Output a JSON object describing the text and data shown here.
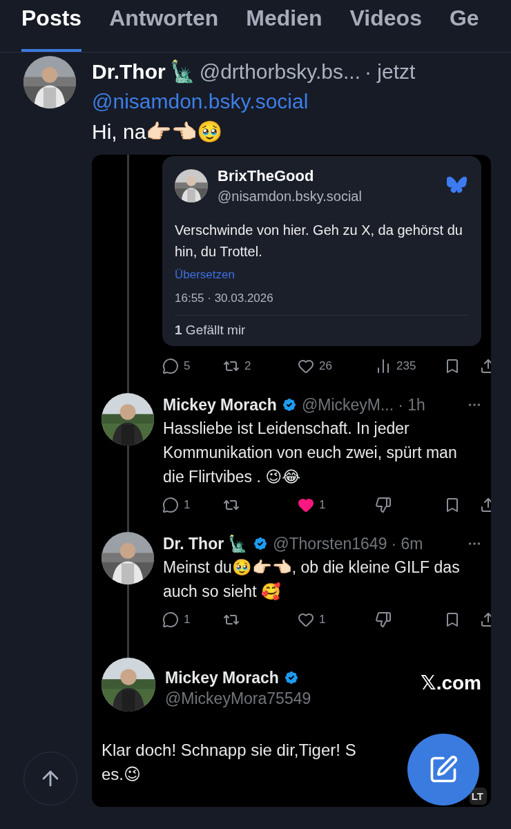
{
  "tabs": [
    {
      "label": "Posts",
      "selected": true
    },
    {
      "label": "Antworten",
      "selected": false
    },
    {
      "label": "Medien",
      "selected": false
    },
    {
      "label": "Videos",
      "selected": false
    },
    {
      "label": "Ge",
      "selected": false
    }
  ],
  "post": {
    "author": "Dr.Thor",
    "author_emoji": "🗽",
    "handle": "@drthorbsky.bs...",
    "time": "· jetzt",
    "mention": "@nisamdon.bsky.social",
    "text": "Hi, na👉🏻👈🏻🥹",
    "screenshot": {
      "quoted": {
        "name": "BrixTheGood",
        "handle": "@nisamdon.bsky.social",
        "text": "Verschwinde von hier. Geh zu X, da gehörst du hin, du Trottel.",
        "translate": "Übersetzen",
        "timestamp": "16:55 · 30.03.2026",
        "likes_count": "1",
        "likes_label": "Gefällt mir"
      },
      "actions": [
        {
          "kind": "reply",
          "count": "5"
        },
        {
          "kind": "repost",
          "count": "2"
        },
        {
          "kind": "like",
          "count": "26",
          "liked": false
        },
        {
          "kind": "views",
          "count": "235"
        },
        {
          "kind": "bookmark"
        },
        {
          "kind": "share"
        }
      ],
      "replies": [
        {
          "name": "Mickey Morach",
          "verified": true,
          "handle": "@MickeyM...",
          "time": "· 1h",
          "text": "Hassliebe ist Leidenschaft. In jeder Kommunikation von euch zwei, spürt man die Flirtvibes . 😉😂",
          "actions": [
            {
              "kind": "reply",
              "count": "1"
            },
            {
              "kind": "repost"
            },
            {
              "kind": "like",
              "count": "1",
              "liked": true
            },
            {
              "kind": "dislike"
            },
            {
              "kind": "bookmark"
            },
            {
              "kind": "share"
            }
          ]
        },
        {
          "name": "Dr. Thor",
          "name_emoji": "🗽",
          "verified": true,
          "handle": "@Thorsten1649",
          "time": "· 6m",
          "text": "Meinst du🥹👉🏻👈🏻, ob die kleine GILF das auch so sieht 🥰",
          "actions": [
            {
              "kind": "reply",
              "count": "1"
            },
            {
              "kind": "repost"
            },
            {
              "kind": "like",
              "count": "1",
              "liked": false
            },
            {
              "kind": "dislike"
            },
            {
              "kind": "bookmark"
            },
            {
              "kind": "share"
            }
          ]
        }
      ],
      "final": {
        "name": "Mickey Morach",
        "verified": true,
        "handle": "@MickeyMora75549",
        "source": "𝕏.com",
        "lines": [
          "Klar doch! Schnapp sie dir,Tiger! S",
          "es.😉"
        ]
      },
      "alt_badge": "LT"
    }
  }
}
